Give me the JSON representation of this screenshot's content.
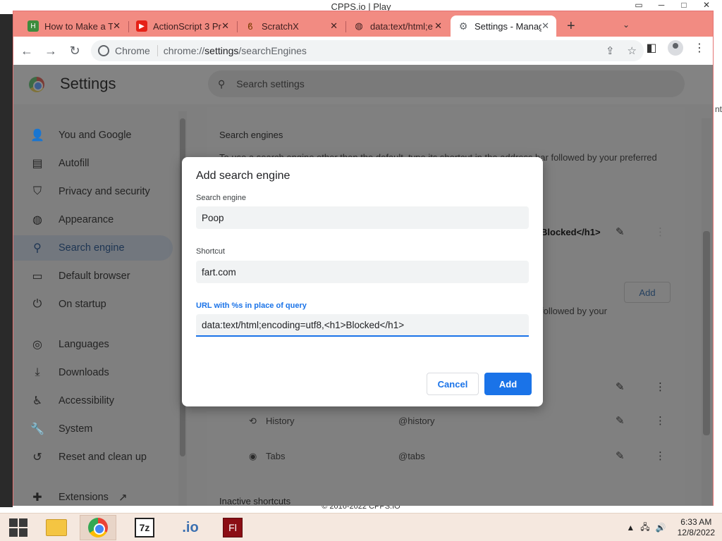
{
  "background": {
    "window_title": "CPPS.io | Play",
    "right_partial_text": "nt",
    "footer": "© 2016-2022 CPPS.IO",
    "controls": [
      "▭",
      "─",
      "□",
      "✕"
    ]
  },
  "tabs": [
    {
      "label": "How to Make a T",
      "icon": "green-logo-icon"
    },
    {
      "label": "ActionScript 3 Pr",
      "icon": "youtube-icon"
    },
    {
      "label": "ScratchX",
      "icon": "scratchx-icon"
    },
    {
      "label": "data:text/html;e",
      "icon": "globe-icon"
    },
    {
      "label": "Settings - Manag",
      "icon": "gear-icon"
    }
  ],
  "toolbar": {
    "back": "←",
    "forward": "→",
    "reload": "↻",
    "site_label": "Chrome",
    "url_scheme": "chrome://",
    "url_host": "settings",
    "url_path": "/searchEngines",
    "new_tab": "+",
    "tab_menu": "⌄"
  },
  "settings": {
    "title": "Settings",
    "search_placeholder": "Search settings",
    "nav": [
      {
        "label": "You and Google",
        "icon": "👤"
      },
      {
        "label": "Autofill",
        "icon": "▤"
      },
      {
        "label": "Privacy and security",
        "icon": "⛉"
      },
      {
        "label": "Appearance",
        "icon": "◍"
      },
      {
        "label": "Search engine",
        "icon": "⚲"
      },
      {
        "label": "Default browser",
        "icon": "▭"
      },
      {
        "label": "On startup",
        "icon": "⏻"
      },
      {
        "label": "Languages",
        "icon": "◎"
      },
      {
        "label": "Downloads",
        "icon": "⤓"
      },
      {
        "label": "Accessibility",
        "icon": "♿"
      },
      {
        "label": "System",
        "icon": "🔧"
      },
      {
        "label": "Reset and clean up",
        "icon": "↺"
      },
      {
        "label": "Extensions",
        "icon": "✚",
        "extra": "↗"
      }
    ],
    "selected_nav": "Search engine",
    "section_title": "Search engines",
    "section_desc": "To use a search engine other than the default, type its shortcut in the address bar followed by your preferred",
    "fragment_blocked": "Blocked</h1>",
    "fragment_followed": "followed by your",
    "add_button": "Add",
    "rows": [
      {
        "icon": "⟲",
        "name": "History",
        "key": "@history"
      },
      {
        "icon": "◉",
        "name": "Tabs",
        "key": "@tabs"
      }
    ],
    "inactive_shortcuts": "Inactive shortcuts"
  },
  "dialog": {
    "title": "Add search engine",
    "engine_label": "Search engine",
    "engine_value": "Poop",
    "shortcut_label": "Shortcut",
    "shortcut_value": "fart.com",
    "url_label": "URL with %s in place of query",
    "url_value": "data:text/html;encoding=utf8,<h1>Blocked</h1>",
    "cancel": "Cancel",
    "add": "Add"
  },
  "taskbar": {
    "time": "6:33 AM",
    "date": "12/8/2022",
    "z7_label": "7z",
    "io_label": ".io",
    "fl_label": "Fl",
    "tray_chevron": "▲",
    "network": "🖧",
    "volume": "🔊"
  },
  "colors": {
    "accent": "#1a73e8",
    "tab_bar": "#f28b82",
    "overlay": "#7f7f7f"
  }
}
